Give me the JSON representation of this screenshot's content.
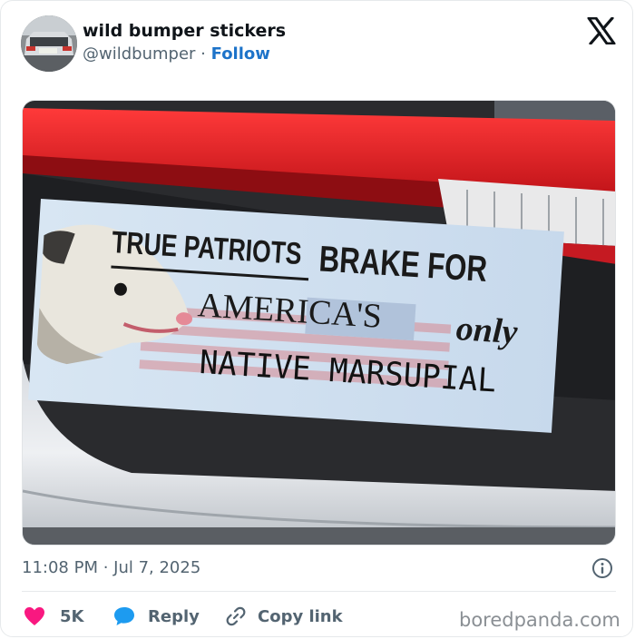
{
  "tweet": {
    "author_name": "wild bumper stickers",
    "handle": "@wildbumper",
    "separator": "·",
    "follow_label": "Follow",
    "timestamp": "11:08 PM · Jul 7, 2025"
  },
  "media": {
    "sticker": {
      "line1a": "TRUE PATRIOTS",
      "line1b": "BRAKE FOR",
      "line2a": "AMERICA'S",
      "line2b": "only",
      "line3": "NATIVE MARSUPIAL"
    }
  },
  "actions": {
    "likes_count": "5K",
    "reply_label": "Reply",
    "copy_link_label": "Copy link"
  },
  "watermark": "boredpanda.com",
  "icons": {
    "platform_logo": "x-logo-icon",
    "info": "info-icon",
    "like": "heart-icon",
    "reply": "reply-bubble-icon",
    "copy": "link-icon"
  },
  "colors": {
    "heart": "#f91880",
    "reply": "#1d9bf0",
    "follow": "#1d73c9",
    "muted": "#536471"
  }
}
